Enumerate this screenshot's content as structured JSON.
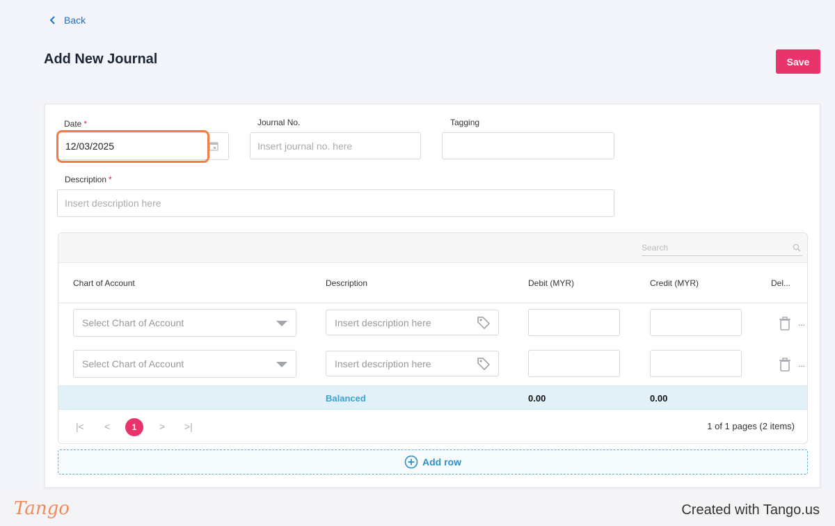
{
  "nav": {
    "back_label": "Back"
  },
  "page": {
    "title": "Add New Journal",
    "save_label": "Save"
  },
  "form": {
    "date": {
      "label": "Date",
      "required_mark": "*",
      "value": "12/03/2025"
    },
    "journal_no": {
      "label": "Journal No.",
      "placeholder": "Insert journal no. here"
    },
    "tagging": {
      "label": "Tagging",
      "value": ""
    },
    "description": {
      "label": "Description",
      "required_mark": "*",
      "placeholder": "Insert description here"
    }
  },
  "grid": {
    "search_placeholder": "Search",
    "columns": [
      "Chart of Account",
      "Description",
      "Debit (MYR)",
      "Credit (MYR)",
      "Del..."
    ],
    "rows": [
      {
        "account_placeholder": "Select Chart of Account",
        "description_placeholder": "Insert description here",
        "debit": "",
        "credit": "",
        "more": "..."
      },
      {
        "account_placeholder": "Select Chart of Account",
        "description_placeholder": "Insert description here",
        "debit": "",
        "credit": "",
        "more": "..."
      }
    ],
    "summary": {
      "status": "Balanced",
      "debit_total": "0.00",
      "credit_total": "0.00"
    },
    "pager": {
      "first": "|<",
      "prev": "<",
      "current_page": "1",
      "next": ">",
      "last": ">|",
      "info": "1 of 1 pages (2 items)"
    },
    "add_row_label": "Add row"
  },
  "footer": {
    "logo_text": "Tango",
    "created_text": "Created with Tango.us"
  },
  "colors": {
    "accent": "#e8336b",
    "link": "#1a6fd0",
    "highlight": "#f17c48",
    "balanced": "#3aa2d6"
  }
}
